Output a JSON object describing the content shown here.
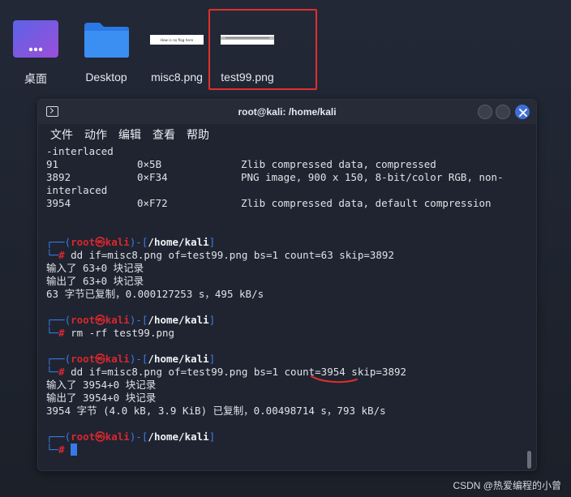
{
  "desktop": {
    "icons": [
      {
        "label": "桌面",
        "icon": "desktop-folder-icon"
      },
      {
        "label": "Desktop",
        "icon": "folder-icon"
      },
      {
        "label": "misc8.png",
        "icon": "image-thumbnail",
        "thumb_text": "How is no flag here"
      },
      {
        "label": "test99.png",
        "icon": "image-thumbnail"
      }
    ],
    "highlight_color": "#e0302d"
  },
  "window": {
    "title": "root@kali: /home/kali",
    "menu": [
      "文件",
      "动作",
      "编辑",
      "查看",
      "帮助"
    ]
  },
  "terminal": {
    "table_rows": [
      {
        "text": "-interlaced"
      },
      {
        "c1": "91",
        "c2": "0×5B",
        "c3": "Zlib compressed data, compressed"
      },
      {
        "c1": "3892",
        "c2": "0×F34",
        "c3": "PNG image, 900 x 150, 8-bit/color RGB, non-"
      },
      {
        "text": "interlaced"
      },
      {
        "c1": "3954",
        "c2": "0×F72",
        "c3": "Zlib compressed data, default compression"
      }
    ],
    "prompt": {
      "user": "root",
      "at": "㉿",
      "host": "kali",
      "path": "/home/kali",
      "symbol": "#"
    },
    "blocks": [
      {
        "command": "dd if=misc8.png of=test99.png bs=1 count=63 skip=3892",
        "output": [
          "输入了 63+0 块记录",
          "输出了 63+0 块记录",
          "63 字节已复制，0.000127253 s，495 kB/s"
        ]
      },
      {
        "command": "rm -rf test99.png",
        "output": []
      },
      {
        "command": "dd if=misc8.png of=test99.png bs=1 count=3954 skip=3892",
        "output": [
          "输入了 3954+0 块记录",
          "输出了 3954+0 块记录",
          "3954 字节 (4.0 kB, 3.9 KiB) 已复制，0.00498714 s，793 kB/s"
        ]
      }
    ]
  },
  "watermark": "CSDN @热爱编程的小曾",
  "colors": {
    "prompt_red": "#d8272e",
    "prompt_blue": "#3d7ce8",
    "close_button": "#3f6fd6"
  }
}
